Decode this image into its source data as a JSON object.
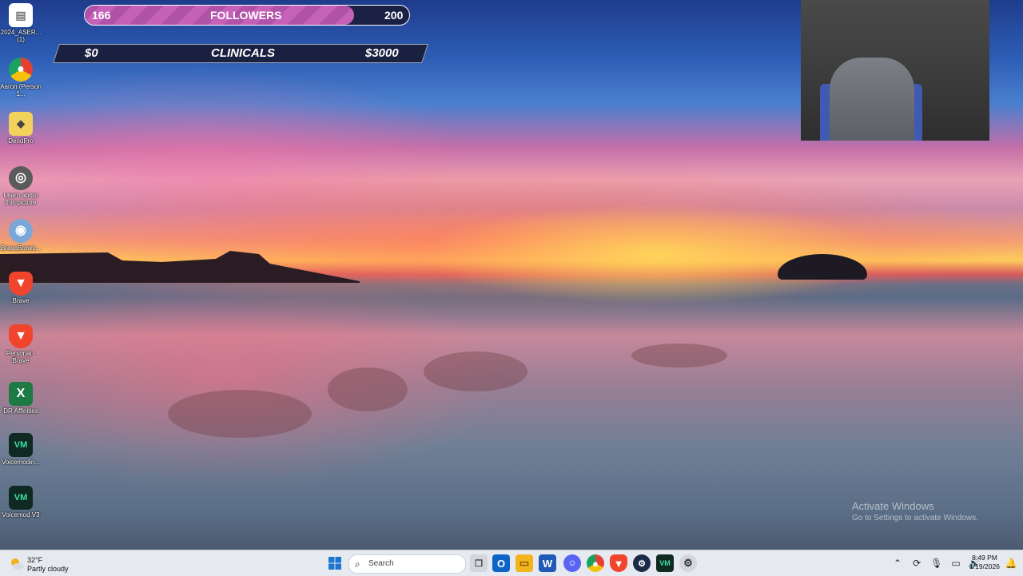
{
  "desktop_icons": [
    {
      "label": "2024_ASER... (1)",
      "icon": "document-icon",
      "color": "#ffffff"
    },
    {
      "label": "Aaron (Person 1...",
      "icon": "chrome-icon",
      "color": "#e44134"
    },
    {
      "label": "DendPro",
      "icon": "shapes-app-icon",
      "color": "#f2d15c"
    },
    {
      "label": "Learn about this picture",
      "icon": "camera-icon",
      "color": "#5b5b5b"
    },
    {
      "label": "BraveBrows...",
      "icon": "installer-disc-icon",
      "color": "#7aa7d8"
    },
    {
      "label": "Brave",
      "icon": "brave-lion-icon",
      "color": "#f0442c"
    },
    {
      "label": "Personal - Brave",
      "icon": "brave-profile-icon",
      "color": "#f0442c"
    },
    {
      "label": "DR Affinities",
      "icon": "excel-icon",
      "color": "#1d7a45"
    },
    {
      "label": "Voicemodin...",
      "icon": "voicemod-icon",
      "color": "#0f2a22"
    },
    {
      "label": "Voicemod V3",
      "icon": "voicemod-icon",
      "color": "#0f2a22"
    }
  ],
  "followers_goal": {
    "current": "166",
    "label": "FOLLOWERS",
    "target": "200",
    "progress": 0.83,
    "fill_color": "#b052a8"
  },
  "clinicals_goal": {
    "start": "$0",
    "label": "CLINICALS",
    "target": "$3000"
  },
  "watermark": {
    "title": "Activate Windows",
    "subtitle": "Go to Settings to activate Windows."
  },
  "taskbar": {
    "weather": {
      "temp": "32°F",
      "condition": "Partly cloudy"
    },
    "search_placeholder": "Search",
    "apps": [
      {
        "name": "start-button",
        "color": "#1c76d2"
      },
      {
        "name": "task-view-button",
        "color": "#5a5f6a"
      },
      {
        "name": "outlook-app",
        "color": "#0f64c8"
      },
      {
        "name": "file-explorer-app",
        "color": "#f3b51c"
      },
      {
        "name": "word-app",
        "color": "#1f5ab8"
      },
      {
        "name": "discord-app",
        "color": "#5865f2"
      },
      {
        "name": "chrome-app",
        "color": "#e44134"
      },
      {
        "name": "brave-app",
        "color": "#f0442c"
      },
      {
        "name": "steam-app",
        "color": "#1b2a46"
      },
      {
        "name": "voicemod-app",
        "color": "#0f2a22"
      },
      {
        "name": "settings-app",
        "color": "#5a5f6a"
      }
    ],
    "clock": {
      "time": "8:49 PM",
      "date": "1/19/2026"
    }
  }
}
